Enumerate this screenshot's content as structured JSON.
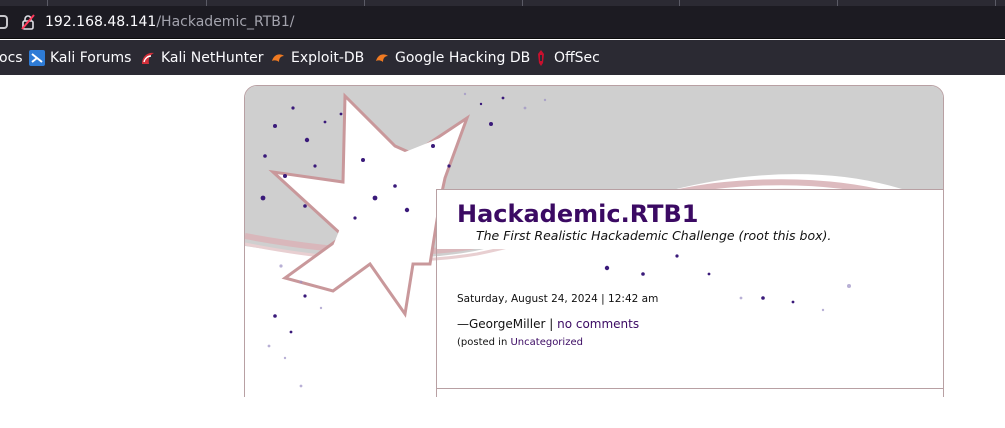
{
  "browser": {
    "url_host": "192.168.48.141",
    "url_path": "/Hackademic_RTB1/",
    "bookmarks": [
      {
        "label": "ocs",
        "icon": "none"
      },
      {
        "label": "Kali Forums",
        "icon": "kali-forums-icon"
      },
      {
        "label": "Kali NetHunter",
        "icon": "kali-nethunter-icon"
      },
      {
        "label": "Exploit-DB",
        "icon": "exploit-db-icon"
      },
      {
        "label": "Google Hacking DB",
        "icon": "ghdb-icon"
      },
      {
        "label": "OffSec",
        "icon": "offsec-icon"
      }
    ]
  },
  "blog": {
    "title": "Hackademic.RTB1",
    "description": "The First Realistic Hackademic Challenge (root this box).",
    "post": {
      "date": "Saturday, August 24, 2024 | 12:42 am",
      "author_prefix": "—GeorgeMiller | ",
      "comments_link": "no comments",
      "posted_in_prefix": "(posted in ",
      "category_link": "Uncategorized"
    }
  },
  "colors": {
    "title": "#3b0a63",
    "link": "#3b0a63",
    "chrome_dark": "#1c1b22",
    "toolbar": "#2b2a33"
  }
}
